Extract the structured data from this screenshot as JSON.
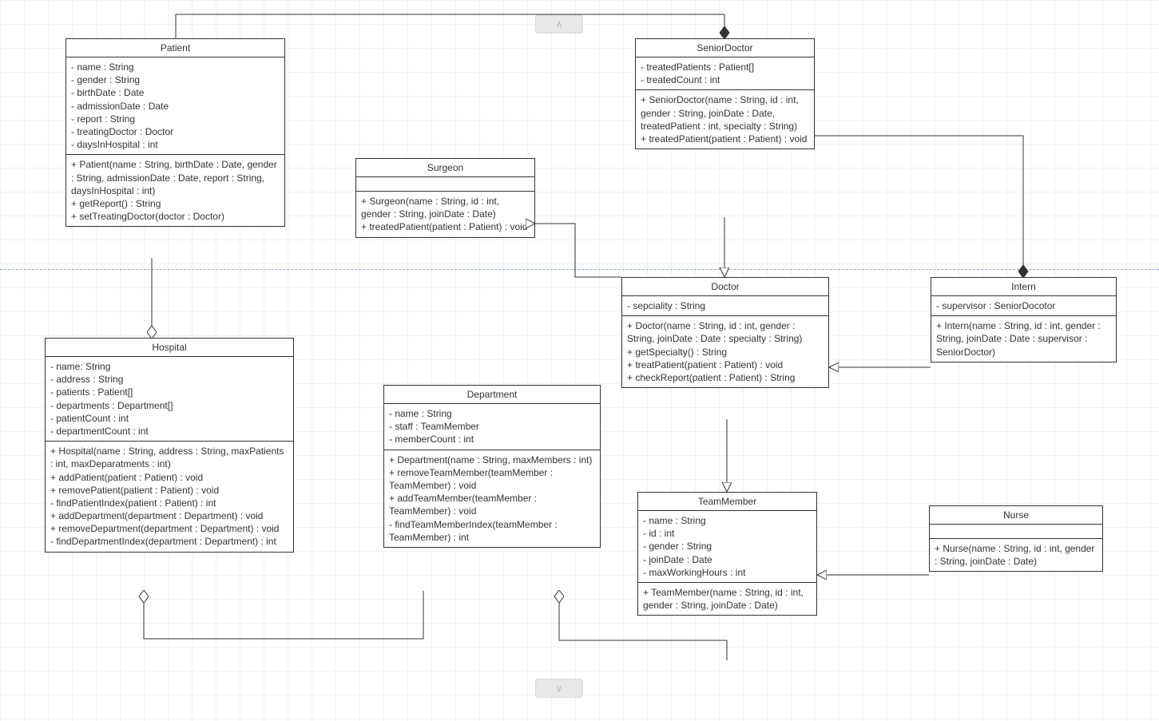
{
  "classes": {
    "patient": {
      "name": "Patient",
      "attrs": "- name : String\n- gender : String\n- birthDate : Date\n- admissionDate : Date\n- report : String\n- treatingDoctor : Doctor\n- daysInHospital : int",
      "ops": "+ Patient(name : String, birthDate : Date, gender : String, admissionDate : Date, report : String, daysInHospital : int)\n+ getReport() : String\n+ setTreatingDoctor(doctor : Doctor)"
    },
    "seniorDoctor": {
      "name": "SeniorDoctor",
      "attrs": "- treatedPatients : Patient[]\n- treatedCount : int",
      "ops": "+ SeniorDoctor(name : String, id : int, gender : String, joinDate : Date, treatedPatient : int, specialty : String)\n+ treatedPatient(patient : Patient) : void"
    },
    "surgeon": {
      "name": "Surgeon",
      "attrs": "",
      "ops": "+ Surgeon(name : String, id : int, gender : String, joinDate : Date)\n+ treatedPatient(patient : Patient) : void"
    },
    "doctor": {
      "name": "Doctor",
      "attrs": "- sepciality : String",
      "ops": "+ Doctor(name : String, id : int, gender : String, joinDate : Date : specialty : String)\n+ getSpecialty() : String\n+ treatPatient(patient : Patient) : void\n+ checkReport(patient : Patient) : String"
    },
    "intern": {
      "name": "Intern",
      "attrs": "- supervisor : SeniorDocotor",
      "ops": "+ Intern(name : String, id : int, gender : String, joinDate : Date : supervisor : SeniorDoctor)"
    },
    "hospital": {
      "name": "Hospital",
      "attrs": "- name: String\n- address : String\n- patients : Patient[]\n- departments : Department[]\n- patientCount : int\n- departmentCount : int",
      "ops": "+ Hospital(name : String, address : String, maxPatients : int, maxDeparatments : int)\n+ addPatient(patient : Patient) : void\n+ removePatient(patient : Patient) : void\n- findPatientIndex(patient : Patient) : int\n+ addDepartment(department : Department) : void\n+ removeDepartment(department : Department) : void\n- findDepartmentIndex(department : Department) : int"
    },
    "department": {
      "name": "Department",
      "attrs": "- name : String\n- staff : TeamMember\n- memberCount : int",
      "ops": "+ Department(name : String, maxMembers : int)\n+ removeTeamMember(teamMember : TeamMember) : void\n+ addTeamMember(teamMember : TeamMember) : void\n- findTeamMemberIndex(teamMember : TeamMember) : int"
    },
    "teamMember": {
      "name": "TeamMember",
      "attrs": "- name : String\n- id : int\n- gender : String\n- joinDate : Date\n- maxWorkingHours : int",
      "ops": "+ TeamMember(name : String, id : int, gender : String, joinDate : Date)"
    },
    "nurse": {
      "name": "Nurse",
      "attrs": "",
      "ops": "+ Nurse(name : String, id : int, gender : String, joinDate : Date)"
    }
  },
  "scroll_tabs": {
    "top_glyph": "∧",
    "bottom_glyph": "∨"
  },
  "relationships": [
    {
      "from": "Hospital",
      "to": "Patient",
      "type": "aggregation"
    },
    {
      "from": "Hospital",
      "to": "Department",
      "type": "aggregation"
    },
    {
      "from": "Department",
      "to": "TeamMember",
      "type": "aggregation"
    },
    {
      "from": "SeniorDoctor",
      "to": "Patient",
      "type": "composition"
    },
    {
      "from": "Intern",
      "to": "SeniorDoctor",
      "type": "composition"
    },
    {
      "from": "Doctor",
      "to": "Surgeon",
      "type": "generalization",
      "dir": "Surgeon extends Doctor"
    },
    {
      "from": "Doctor",
      "to": "SeniorDoctor",
      "type": "generalization",
      "dir": "SeniorDoctor via Doctor"
    },
    {
      "from": "Doctor",
      "to": "Intern",
      "type": "generalization",
      "dir": "Intern extends Doctor"
    },
    {
      "from": "TeamMember",
      "to": "Doctor",
      "type": "generalization",
      "dir": "Doctor extends TeamMember"
    },
    {
      "from": "TeamMember",
      "to": "Nurse",
      "type": "generalization",
      "dir": "Nurse extends TeamMember"
    }
  ]
}
